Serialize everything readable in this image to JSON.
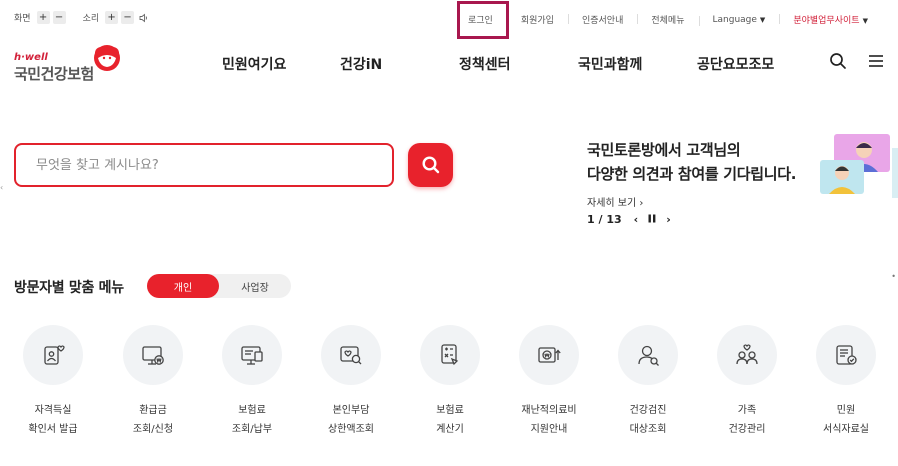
{
  "utility": {
    "screen_label": "화면",
    "sound_label": "소리",
    "plus": "+",
    "minus": "−",
    "links": {
      "login": "로그인",
      "signup": "회원가입",
      "certificate": "인증서안내",
      "sitemap": "전체메뉴",
      "language": "Language",
      "related_sites": "분야별업무사이트"
    }
  },
  "logo": {
    "small": "h·well",
    "main": "국민건강보험"
  },
  "nav": {
    "items": [
      "민원여기요",
      "건강iN",
      "정책센터",
      "국민과함께",
      "공단요모조모"
    ]
  },
  "search": {
    "placeholder": "무엇을 찾고 계시나요?"
  },
  "banner": {
    "title_line1": "국민토론방에서 고객님의",
    "title_line2": "다양한 의견과 참여를 기다립니다.",
    "more": "자세히 보기",
    "current": "1",
    "total": "13",
    "page_text": "1 / 13"
  },
  "custom_menu": {
    "title": "방문자별 맞춤 메뉴",
    "tabs": [
      "개인",
      "사업장"
    ],
    "items": [
      {
        "line1": "자격득실",
        "line2": "확인서 발급",
        "icon": "certificate-heart-icon"
      },
      {
        "line1": "환급금",
        "line2": "조회/신청",
        "icon": "monitor-won-icon"
      },
      {
        "line1": "보험료",
        "line2": "조회/납부",
        "icon": "monitor-document-icon"
      },
      {
        "line1": "본인부담",
        "line2": "상한액조회",
        "icon": "search-heart-icon"
      },
      {
        "line1": "보험료",
        "line2": "계산기",
        "icon": "calculator-icon"
      },
      {
        "line1": "재난적의료비",
        "line2": "지원안내",
        "icon": "won-support-icon"
      },
      {
        "line1": "건강검진",
        "line2": "대상조회",
        "icon": "person-search-icon"
      },
      {
        "line1": "가족",
        "line2": "건강관리",
        "icon": "family-heart-icon"
      },
      {
        "line1": "민원",
        "line2": "서식자료실",
        "icon": "form-check-icon"
      }
    ]
  },
  "colors": {
    "accent": "#e8222c",
    "login_highlight": "#a8174e",
    "related_sites": "#d2213a"
  }
}
